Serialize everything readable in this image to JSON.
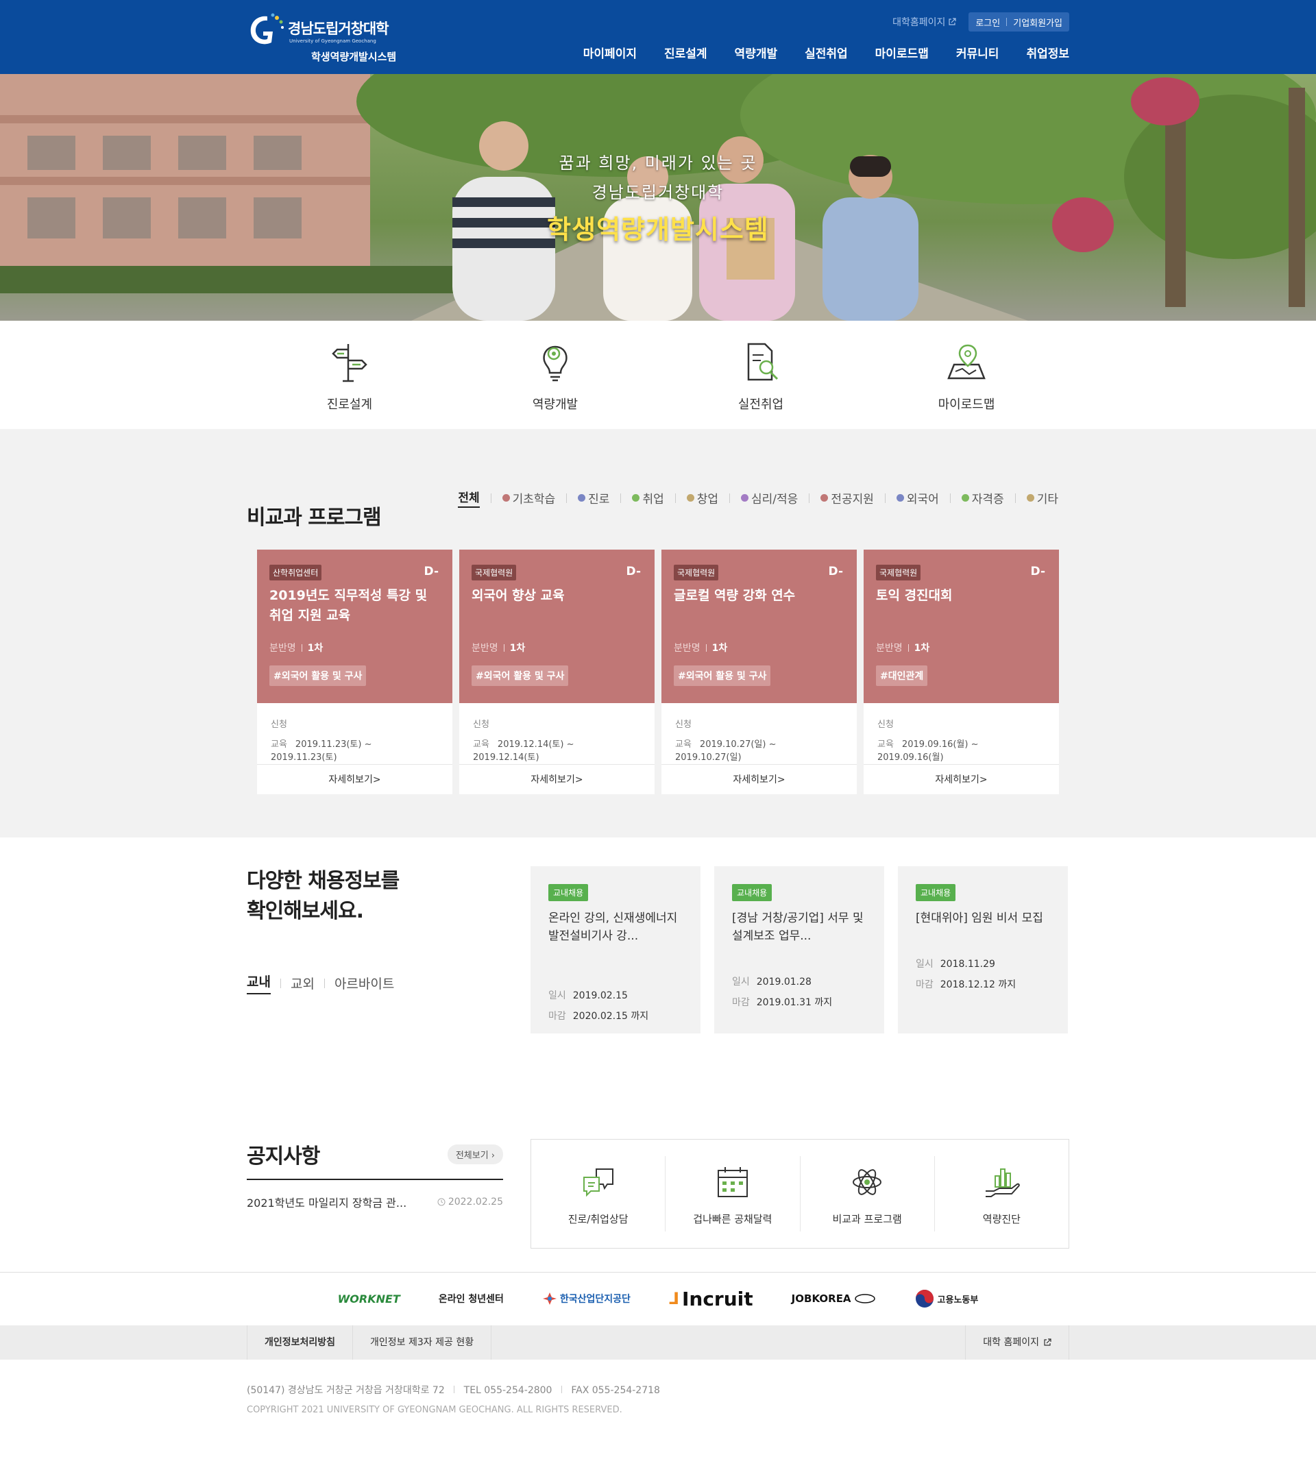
{
  "header": {
    "logo_univ": "경남도립거창대학",
    "logo_eng": "University of Gyeongnam Geochang",
    "logo_sys": "학생역량개발시스템",
    "univ_link": "대학홈페이지",
    "login": "로그인",
    "join": "기업회원가입",
    "gnb": [
      "마이페이지",
      "진로설계",
      "역량개발",
      "실전취업",
      "마이로드맵",
      "커뮤니티",
      "취업정보"
    ],
    "brand_color": "#0a4b9c"
  },
  "hero": {
    "line1": "꿈과 희망, 미래가 있는 곳",
    "line2": "경남도립거창대학",
    "line3": "학생역량개발시스템"
  },
  "quick": [
    {
      "label": "진로설계",
      "icon": "signpost-icon"
    },
    {
      "label": "역량개발",
      "icon": "lightbulb-gear-icon"
    },
    {
      "label": "실전취업",
      "icon": "document-search-icon"
    },
    {
      "label": "마이로드맵",
      "icon": "map-pin-icon"
    }
  ],
  "programs": {
    "title": "비교과 프로그램",
    "filters": [
      {
        "label": "전체",
        "color": ""
      },
      {
        "label": "기초학습",
        "color": "#c07776"
      },
      {
        "label": "진로",
        "color": "#7a86c4"
      },
      {
        "label": "취업",
        "color": "#7dba5d"
      },
      {
        "label": "창업",
        "color": "#c2a86e"
      },
      {
        "label": "심리/적응",
        "color": "#a37bc4"
      },
      {
        "label": "전공지원",
        "color": "#c07776"
      },
      {
        "label": "외국어",
        "color": "#7a86c4"
      },
      {
        "label": "자격증",
        "color": "#7dba5d"
      },
      {
        "label": "기타",
        "color": "#c2a86e"
      }
    ],
    "cards": [
      {
        "tag": "산학취업센터",
        "dday": "D-",
        "title": "2019년도 직무적성 특강 및 취업 지원 교육",
        "meta_label": "분반명",
        "meta_value": "1차",
        "hashtag": "#외국어 활용 및 구사",
        "apply_label": "신청",
        "edu_label": "교육",
        "edu_dates": "2019.11.23(토) ~ 2019.11.23(토)",
        "more": "자세히보기>"
      },
      {
        "tag": "국제협력원",
        "dday": "D-",
        "title": "외국어 향상 교육",
        "meta_label": "분반명",
        "meta_value": "1차",
        "hashtag": "#외국어 활용 및 구사",
        "apply_label": "신청",
        "edu_label": "교육",
        "edu_dates": "2019.12.14(토) ~ 2019.12.14(토)",
        "more": "자세히보기>"
      },
      {
        "tag": "국제협력원",
        "dday": "D-",
        "title": "글로컬 역량 강화 연수",
        "meta_label": "분반명",
        "meta_value": "1차",
        "hashtag": "#외국어 활용 및 구사",
        "apply_label": "신청",
        "edu_label": "교육",
        "edu_dates": "2019.10.27(일) ~ 2019.10.27(일)",
        "more": "자세히보기>"
      },
      {
        "tag": "국제협력원",
        "dday": "D-",
        "title": "토익 경진대회",
        "meta_label": "분반명",
        "meta_value": "1차",
        "hashtag": "#대인관계",
        "apply_label": "신청",
        "edu_label": "교육",
        "edu_dates": "2019.09.16(월) ~ 2019.09.16(월)",
        "more": "자세히보기>"
      }
    ]
  },
  "jobs": {
    "title_l1": "다양한 채용정보를",
    "title_l2": "확인해보세요.",
    "tabs": [
      "교내",
      "교외",
      "아르바이트"
    ],
    "cards": [
      {
        "tag": "교내채용",
        "title": "온라인 강의, 신재생에너지발전설비기사 강...",
        "date_label": "일시",
        "date": "2019.02.15",
        "deadline_label": "마감",
        "deadline": "2020.02.15 까지"
      },
      {
        "tag": "교내채용",
        "title": "[경남 거창/공기업] 서무 및 설계보조 업무...",
        "date_label": "일시",
        "date": "2019.01.28",
        "deadline_label": "마감",
        "deadline": "2019.01.31 까지"
      },
      {
        "tag": "교내채용",
        "title": "[현대위아] 임원 비서 모집",
        "date_label": "일시",
        "date": "2018.11.29",
        "deadline_label": "마감",
        "deadline": "2018.12.12 까지"
      }
    ]
  },
  "notice": {
    "title": "공지사항",
    "all_button": "전체보기",
    "items": [
      {
        "title": "2021학년도 마일리지 장학금 관...",
        "date": "2022.02.25"
      }
    ]
  },
  "services": [
    {
      "label": "진로/취업상담",
      "icon": "chat-bubbles-icon"
    },
    {
      "label": "겁나빠른 공채달력",
      "icon": "calendar-icon"
    },
    {
      "label": "비교과 프로그램",
      "icon": "atom-icon"
    },
    {
      "label": "역량진단",
      "icon": "hand-chart-icon"
    }
  ],
  "partners": [
    "WORKNET",
    "온라인 청년센터",
    "한국산업단지공단",
    "Incruit",
    "JOBKOREA",
    "고용노동부"
  ],
  "footer_nav": {
    "privacy": "개인정보처리방침",
    "third_party": "개인정보 제3자 제공 현황",
    "univ_home": "대학 홈페이지"
  },
  "footer": {
    "address": "(50147) 경상남도 거창군 거창읍 거창대학로 72",
    "tel": "TEL 055-254-2800",
    "fax": "FAX 055-254-2718",
    "copyright": "COPYRIGHT 2021 UNIVERSITY OF GYEONGNAM GEOCHANG. ALL RIGHTS RESERVED."
  }
}
